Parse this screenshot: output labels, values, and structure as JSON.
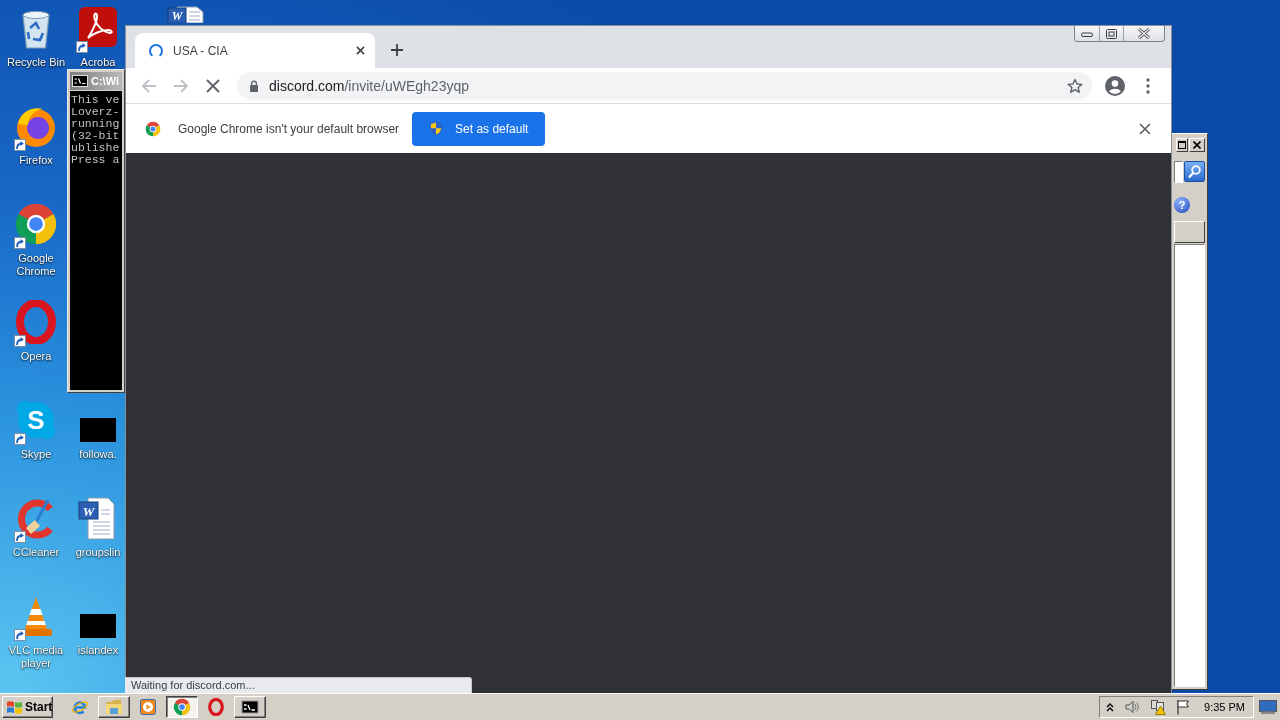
{
  "desktop": {
    "icons": [
      {
        "label": "Recycle Bin",
        "kind": "recycle-bin",
        "shortcut": false
      },
      {
        "label": "Firefox",
        "kind": "firefox",
        "shortcut": true
      },
      {
        "label": "Google Chrome",
        "kind": "chrome",
        "shortcut": true
      },
      {
        "label": "Opera",
        "kind": "opera",
        "shortcut": true
      },
      {
        "label": "Skype",
        "kind": "skype",
        "glyph": "S",
        "shortcut": true
      },
      {
        "label": "CCleaner",
        "kind": "ccleaner",
        "shortcut": true
      },
      {
        "label": "VLC media player",
        "kind": "vlc",
        "shortcut": true
      },
      {
        "label": "Acroba",
        "kind": "acrobat",
        "shortcut": true
      },
      {
        "label": "followa.",
        "kind": "blank-thumbnail",
        "shortcut": false
      },
      {
        "label": "groupslin",
        "kind": "word-document",
        "glyph": "W",
        "shortcut": false
      },
      {
        "label": "islandex",
        "kind": "blank-thumbnail",
        "shortcut": false
      },
      {
        "kind": "word-document",
        "glyph": "W",
        "shortcut": false
      }
    ]
  },
  "console_window": {
    "title": "C:\\Wi",
    "lines": [
      "This ve",
      "Loverz-",
      "running",
      "(32-bit",
      "ublishe",
      "Press a"
    ]
  },
  "background_window": {
    "help_glyph": "?"
  },
  "browser": {
    "tabs": [
      {
        "title": "USA - CIA",
        "selected": true,
        "loading": true
      }
    ],
    "nav": [
      {
        "kind": "back",
        "disabled": true
      },
      {
        "kind": "forward",
        "disabled": true
      },
      {
        "kind": "stop",
        "disabled": false
      }
    ],
    "address": {
      "host": "discord.com",
      "path": "/invite/uWEgh23yqp"
    },
    "bookmarked": false,
    "infobar": {
      "message": "Google Chrome isn't your default browser",
      "button": "Set as default"
    },
    "status": "Waiting for discord.com..."
  },
  "taskbar": {
    "start": "Start",
    "items": [
      {
        "kind": "internet-explorer",
        "open": false,
        "selected": false
      },
      {
        "kind": "file-explorer",
        "open": true,
        "selected": false
      },
      {
        "kind": "media-player",
        "open": false,
        "selected": false
      },
      {
        "kind": "chrome",
        "open": true,
        "selected": true
      },
      {
        "kind": "opera",
        "open": false,
        "selected": false
      },
      {
        "kind": "console",
        "open": true,
        "selected": false
      }
    ],
    "clock": "9:35 PM"
  }
}
